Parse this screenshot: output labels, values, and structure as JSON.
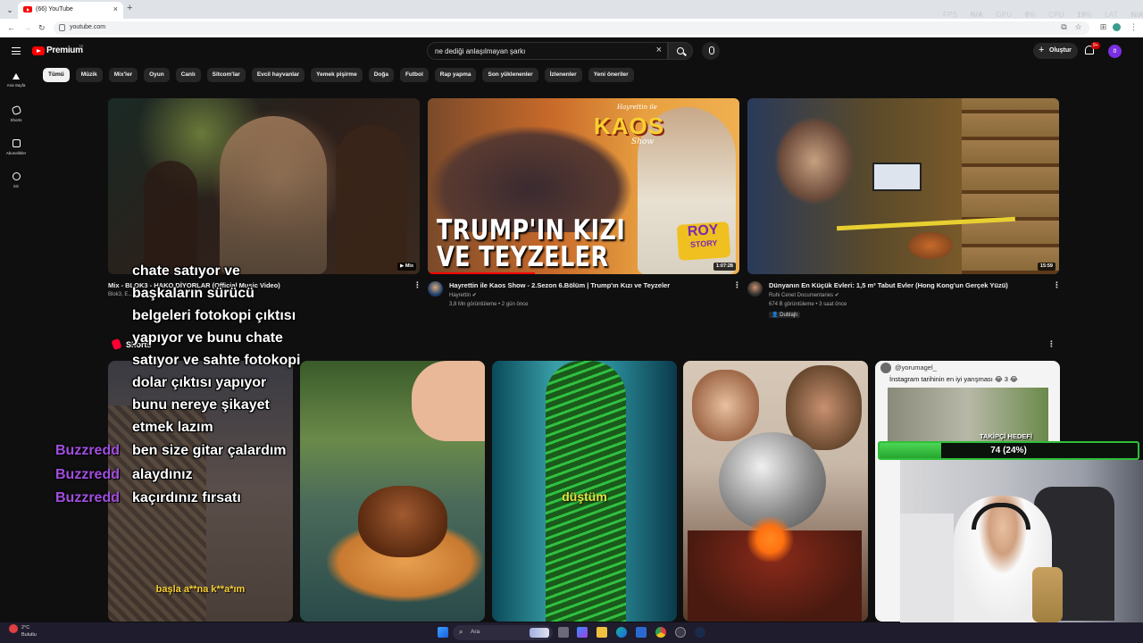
{
  "browser": {
    "tab_title": "(66) YouTube",
    "url": "youtube.com",
    "overlay": {
      "fps_label": "FPS",
      "fps_value": "N/A",
      "gpu_label": "GPU",
      "gpu_value": "8",
      "cpu_label": "CPU",
      "cpu_value": "19",
      "lat_label": "LAT",
      "lat_value": "N/A"
    }
  },
  "header": {
    "logo_text": "Premium",
    "logo_sup": "TR",
    "search_query": "ne dediği anlaşılmayan şarkı",
    "create_label": "Oluştur",
    "notif_count": "9+",
    "avatar_letter": "ö"
  },
  "sidebar": {
    "items": [
      {
        "label": "Ana Sayfa",
        "icon": "home-icon"
      },
      {
        "label": "Shorts",
        "icon": "shorts-icon"
      },
      {
        "label": "Abonelikler",
        "icon": "subscriptions-icon"
      },
      {
        "label": "Siz",
        "icon": "you-icon"
      }
    ]
  },
  "chips": [
    "Tümü",
    "Müzik",
    "Mix'ler",
    "Oyun",
    "Canlı",
    "Sitcom'lar",
    "Evcil hayvanlar",
    "Yemek pişirme",
    "Doğa",
    "Futbol",
    "Rap yapma",
    "Son yüklenenler",
    "İzlenenler",
    "Yeni öneriler"
  ],
  "videos": [
    {
      "title": "Mix - BLOK3 - HAKO DİYORLAR (Official Music Video)",
      "channel": "Blok3, E...",
      "badge": "Mix"
    },
    {
      "title": "Hayrettin ile Kaos Show - 2.Sezon 6.Bölüm | Trump'ın Kızı ve Teyzeler",
      "channel": "Hayrettin",
      "stats": "3,8 Mn görüntüleme • 2 gün önce",
      "duration": "1:07:28",
      "thumb_top": "Hayrettin ile",
      "thumb_logo": "KAOS",
      "thumb_logo2": "Show",
      "thumb_line1": "TRUMP'IN KIZI",
      "thumb_line2": "VE TEYZELER",
      "thumb_badge1": "ROY",
      "thumb_badge2": "STORY"
    },
    {
      "title": "Dünyanın En Küçük Evleri: 1,5 m³ Tabut Evler (Hong Kong'un Gerçek Yüzü)",
      "channel": "Ruhi Cenet Documentaries",
      "stats": "674 B görüntüleme • 3 saat önce",
      "tag": "Dublajlı",
      "duration": "15:59"
    }
  ],
  "shorts": {
    "section_label": "Shorts",
    "captions": [
      "başla a**na k**a*ım",
      "",
      "düştüm",
      "",
      ""
    ],
    "last_card_user": "@yorumagel_",
    "last_card_text": "İnstagram tarihinin en iyi yarışması 😂 3 😂"
  },
  "chat": {
    "lines": [
      "chate satıyor ve",
      "başkaların sürücü",
      "belgeleri fotokopi çıktısı",
      "yapıyor ve bunu chate",
      "satıyor ve sahte fotokopi",
      "dolar çıktısı yapıyor",
      "bunu nereye şikayet",
      "etmek lazım"
    ],
    "messages": [
      {
        "user": "Buzzredd",
        "text": "ben size gitar çalardım"
      },
      {
        "user": "Buzzredd",
        "text": "alaydınız"
      },
      {
        "user": "Buzzredd",
        "text": "kaçırdınız fırsatı"
      }
    ]
  },
  "goal": {
    "label": "TAKİPÇİ HEDEFİ",
    "text": "74 (24%)",
    "progress": 0.24
  },
  "taskbar": {
    "weather_temp": "2°C",
    "weather_desc": "Bulutlu",
    "search_placeholder": "Ara"
  },
  "colors": {
    "yt_red": "#ff0000",
    "background": "#0f0f0f",
    "chip_bg": "#272727",
    "chat_name": "#a24ee0",
    "goal_green": "#2fbf3a"
  }
}
